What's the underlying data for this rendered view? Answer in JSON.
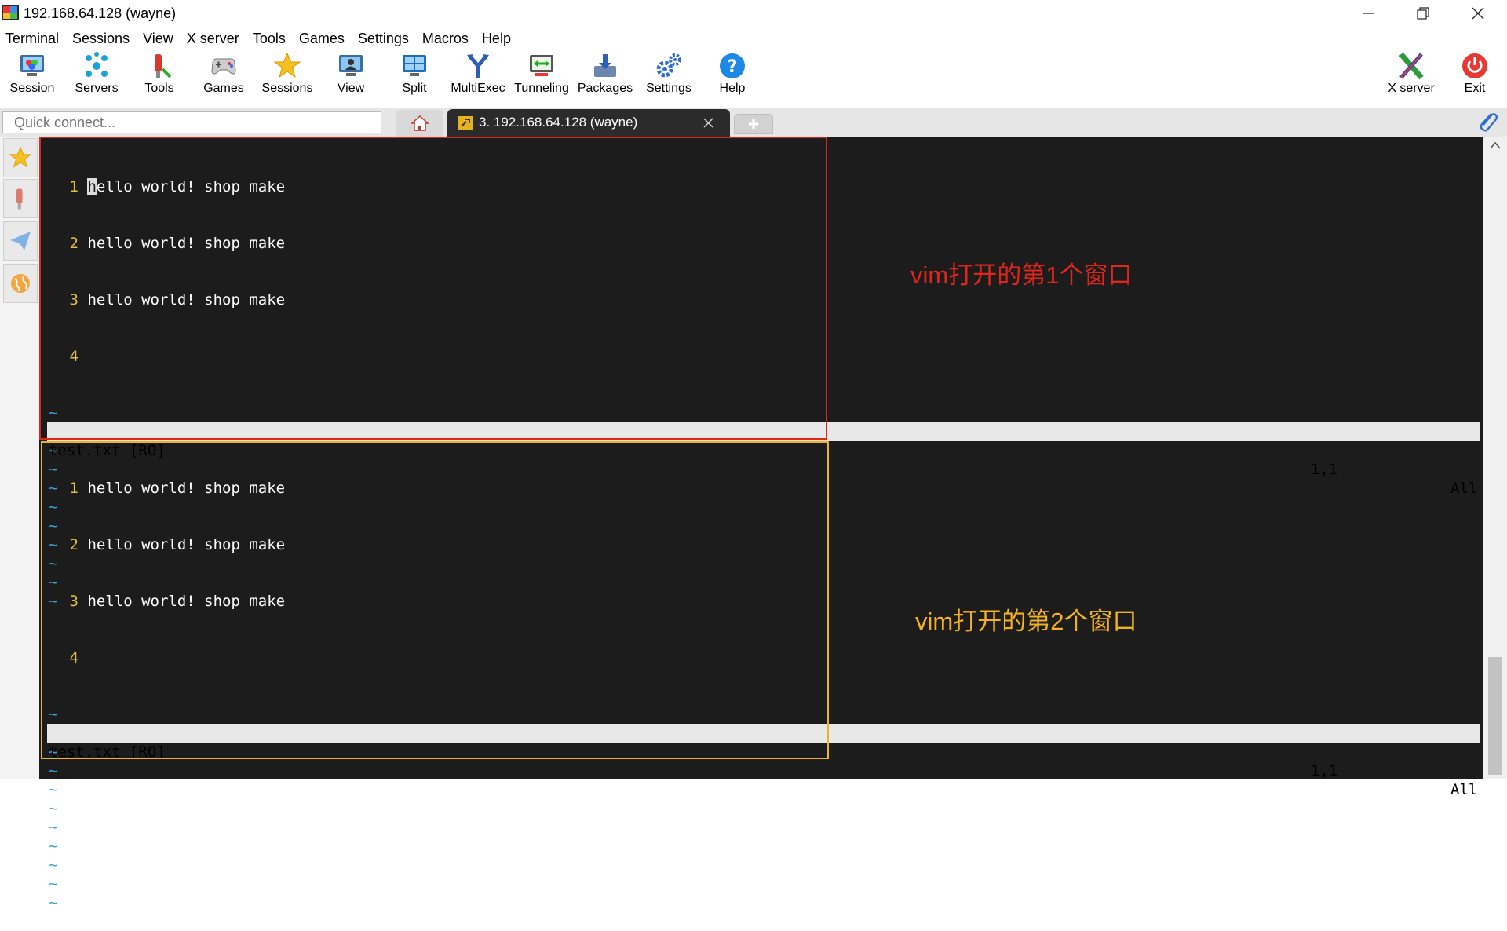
{
  "window": {
    "title": "192.168.64.128 (wayne)",
    "controls": [
      "minimize",
      "restore",
      "close"
    ]
  },
  "menu": [
    "Terminal",
    "Sessions",
    "View",
    "X server",
    "Tools",
    "Games",
    "Settings",
    "Macros",
    "Help"
  ],
  "toolbar": {
    "session": "Session",
    "servers": "Servers",
    "tools": "Tools",
    "games": "Games",
    "sessions": "Sessions",
    "view": "View",
    "split": "Split",
    "multiexec": "MultiExec",
    "tunneling": "Tunneling",
    "packages": "Packages",
    "settings": "Settings",
    "help": "Help",
    "xserver": "X server",
    "exit": "Exit"
  },
  "tabs": {
    "quick_connect_placeholder": "Quick connect...",
    "active_tab": "3. 192.168.64.128 (wayne)"
  },
  "vim": {
    "pane1": {
      "lines": [
        {
          "num": "1",
          "text": "hello world! shop make"
        },
        {
          "num": "2",
          "text": "hello world! shop make"
        },
        {
          "num": "3",
          "text": "hello world! shop make"
        },
        {
          "num": "4",
          "text": ""
        }
      ],
      "tilde_count": 11,
      "status_file": "test.txt [RO]",
      "status_pos": "1,1",
      "status_scroll": "All"
    },
    "pane2": {
      "lines": [
        {
          "num": "1",
          "text": "hello world! shop make"
        },
        {
          "num": "2",
          "text": "hello world! shop make"
        },
        {
          "num": "3",
          "text": "hello world! shop make"
        },
        {
          "num": "4",
          "text": ""
        }
      ],
      "tilde_count": 11,
      "status_file": "test.txt [RO]",
      "status_pos": "1,1",
      "status_scroll": "All"
    }
  },
  "annotations": {
    "pane1_label": "vim打开的第1个窗口",
    "pane1_color": "#e0261b",
    "pane2_label": "vim打开的第2个窗口",
    "pane2_color": "#f2b21c"
  }
}
